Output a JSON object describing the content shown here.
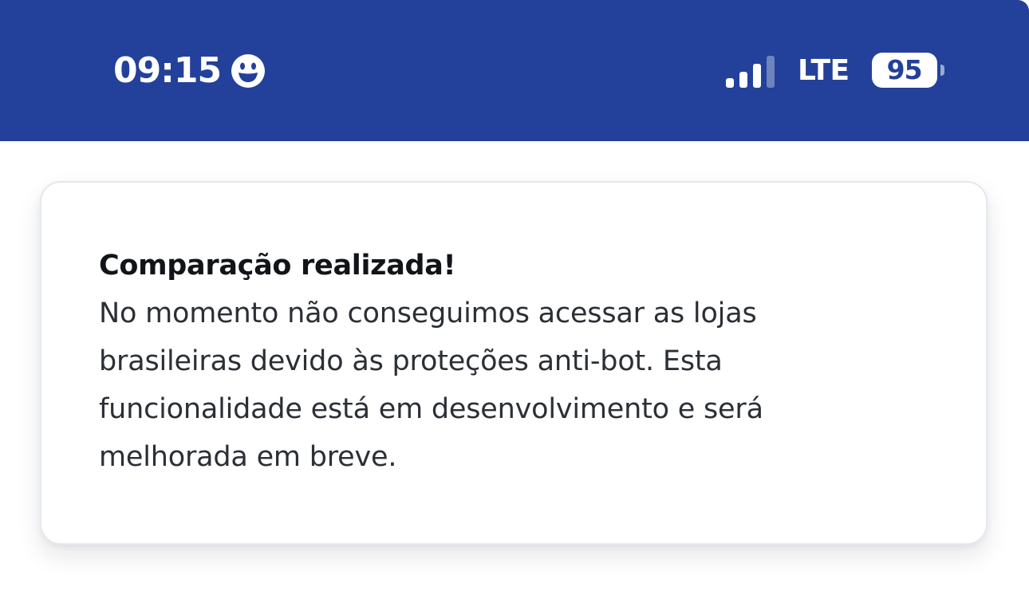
{
  "status_bar": {
    "time": "09:15",
    "network": "LTE",
    "battery_level": "95",
    "icons": {
      "focus": "smiley-face-icon",
      "signal": "cellular-signal-icon",
      "battery": "battery-icon"
    },
    "signal_bars_active": 3,
    "signal_bars_total": 4,
    "background_color": "#23419a"
  },
  "toast": {
    "title": "Comparação realizada!",
    "message": "No momento não conseguimos acessar as lojas brasileiras devido às proteções anti-bot. Esta funcionalidade está em desenvolvimento e será melhorada em breve."
  }
}
